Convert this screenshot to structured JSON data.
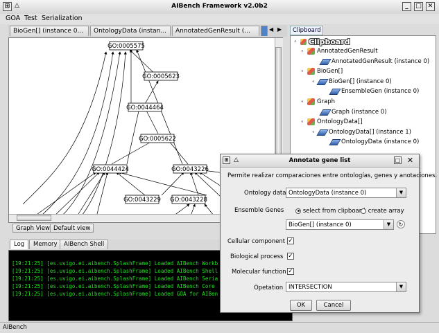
{
  "window": {
    "title": "AIBench Framework v2.0b2"
  },
  "menu": [
    "GOA",
    "Test",
    "Serialization"
  ],
  "doc_tabs": [
    "BioGen[] (instance 0...",
    "OntologyData (instan...",
    "AnnotatedGenResult (..."
  ],
  "graph": {
    "nodes": [
      "GO:0005575",
      "GO:0005623",
      "GO:0044464",
      "GO:0005622",
      "GO:0044424",
      "GO:0043226",
      "GO:0043229",
      "GO:0043228"
    ],
    "view_tabs": [
      "Graph View",
      "Default view"
    ]
  },
  "clipboard": {
    "tab": "Clipboard",
    "header": "Clipboard",
    "items": [
      "AnnotatedGenResult",
      "AnnotatedGenResult (instance 0)",
      "BioGen[]",
      "BioGen[] (instance 0)",
      "EnsembleGen (instance 0)",
      "Graph",
      "Graph (instance 0)",
      "OntologyData[]",
      "OntologyData[] (instance 1)",
      "OntologyData (instance 0)"
    ]
  },
  "log": {
    "tabs": [
      "Log",
      "Memory",
      "AIBench Shell"
    ],
    "lines": [
      "[19:21:25] [es.uvigo.ei.aibench.SplashFrame] Loaded AIBench Workb",
      "[19:21:25] [es.uvigo.ei.aibench.SplashFrame] Loaded AIBench Shell",
      "[19:21:25] [es.uvigo.ei.aibench.SplashFrame] Loaded AIBench Seria",
      "[19:21:25] [es.uvigo.ei.aibench.SplashFrame] Loaded AIBench Core",
      "[19:21:25] [es.uvigo.ei.aibench.SplashFrame] Loaded GOA for AIBen"
    ]
  },
  "status": "AIBench",
  "dialog": {
    "title": "Annotate gene list",
    "description": "Permite realizar comparaciones entre ontologías, genes y anotaciones.",
    "ontology_label": "Ontology data",
    "ontology_value": "OntologyData (instance 0)",
    "ensemble_label": "Ensemble Genes",
    "radio_clipboard": "select from clipboard",
    "radio_create": "create array",
    "ensemble_value": "BioGen[] (instance 0)",
    "cellular_label": "Cellular component",
    "biological_label": "Biological process",
    "molecular_label": "Molecular function",
    "operation_label": "Opetation",
    "operation_value": "INTERSECTION",
    "ok": "OK",
    "cancel": "Cancel"
  }
}
